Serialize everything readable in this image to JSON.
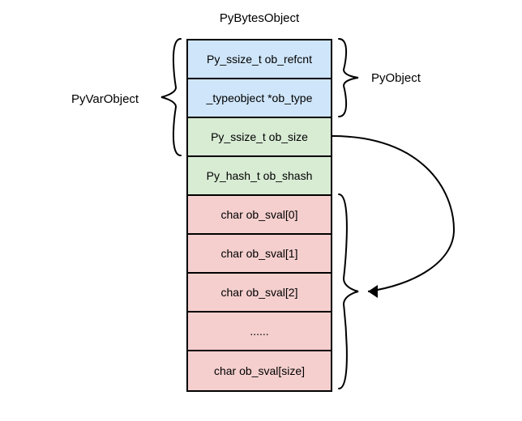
{
  "title": "PyBytesObject",
  "labels": {
    "pyvarobject": "PyVarObject",
    "pyobject": "PyObject"
  },
  "cells": [
    {
      "text": "Py_ssize_t ob_refcnt",
      "color": "blue"
    },
    {
      "text": "_typeobject *ob_type",
      "color": "blue"
    },
    {
      "text": "Py_ssize_t ob_size",
      "color": "green"
    },
    {
      "text": "Py_hash_t ob_shash",
      "color": "green"
    },
    {
      "text": "char ob_sval[0]",
      "color": "red"
    },
    {
      "text": "char ob_sval[1]",
      "color": "red"
    },
    {
      "text": "char ob_sval[2]",
      "color": "red"
    },
    {
      "text": "......",
      "color": "red"
    },
    {
      "text": "char ob_sval[size]",
      "color": "red"
    }
  ]
}
